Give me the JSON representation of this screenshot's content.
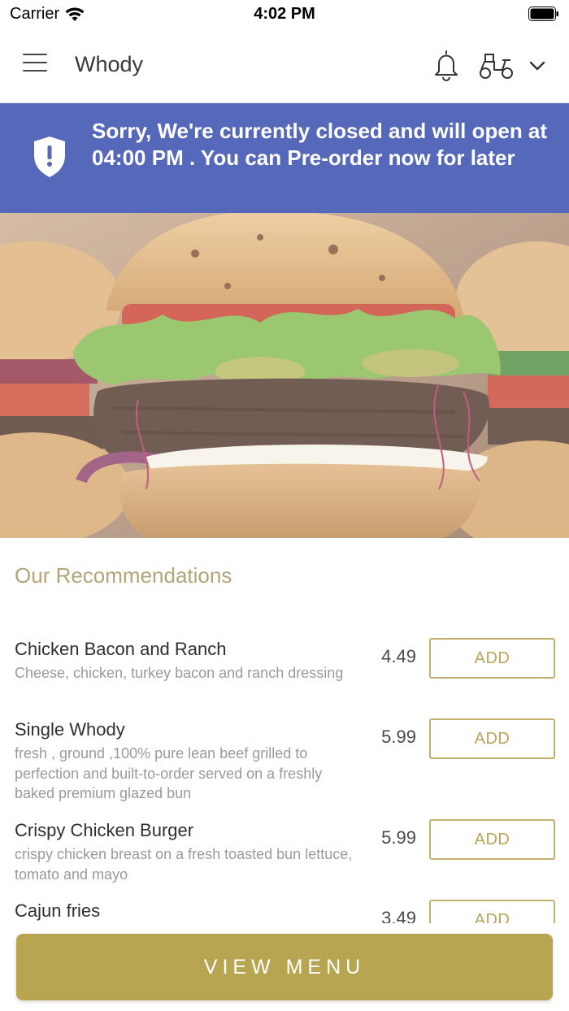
{
  "status_bar": {
    "carrier": "Carrier",
    "time": "4:02 PM",
    "icons": [
      "wifi-icon",
      "battery-icon"
    ]
  },
  "header": {
    "title": "Whody",
    "icons": [
      "hamburger-menu-icon",
      "bell-icon",
      "scooter-delivery-icon",
      "chevron-down-icon"
    ]
  },
  "banner": {
    "message": "Sorry, We're currently closed and will open at 04:00 PM . You can Pre-order now for later",
    "icon": "shield-alert-icon",
    "background_color": "#5568b9"
  },
  "hero": {
    "icon": "burger-photo"
  },
  "recommendations": {
    "title": "Our Recommendations",
    "add_label": "ADD",
    "items": [
      {
        "name": "Chicken Bacon and Ranch",
        "description": "Cheese, chicken, turkey bacon and ranch dressing",
        "price": "4.49"
      },
      {
        "name": "Single Whody",
        "description": "fresh , ground ,100% pure lean beef grilled to perfection and built-to-order served on a freshly baked premium glazed bun",
        "price": "5.99"
      },
      {
        "name": "Crispy Chicken Burger",
        "description": "crispy chicken breast on a fresh toasted bun lettuce, tomato and mayo",
        "price": "5.99"
      },
      {
        "name": "Cajun fries",
        "description": "",
        "price": "3.49"
      }
    ]
  },
  "footer": {
    "view_menu_label": "VIEW MENU"
  },
  "colors": {
    "accent_gold": "#b8a552",
    "banner_blue": "#5568b9",
    "section_title": "#b3a57a"
  }
}
